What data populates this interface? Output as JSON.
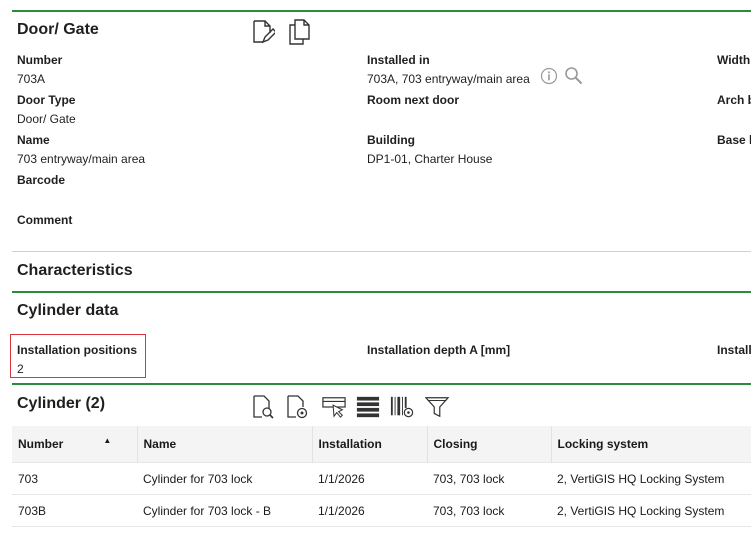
{
  "door": {
    "title": "Door/ Gate",
    "fields": {
      "number": {
        "label": "Number",
        "value": "703A"
      },
      "door_type": {
        "label": "Door Type",
        "value": "Door/ Gate"
      },
      "name": {
        "label": "Name",
        "value": "703 entryway/main area"
      },
      "barcode": {
        "label": "Barcode",
        "value": ""
      },
      "comment": {
        "label": "Comment",
        "value": ""
      },
      "installed_in": {
        "label": "Installed in",
        "value": "703A, 703 entryway/main area"
      },
      "room_next_door": {
        "label": "Room next door",
        "value": ""
      },
      "building": {
        "label": "Building",
        "value": "DP1-01, Charter House"
      },
      "width": {
        "label": "Width",
        "value": ""
      },
      "arch": {
        "label": "Arch b",
        "value": ""
      },
      "base": {
        "label": "Base h",
        "value": ""
      }
    }
  },
  "characteristics": {
    "title": "Characteristics"
  },
  "cylinder_data": {
    "title": "Cylinder data",
    "installation_positions": {
      "label": "Installation positions",
      "value": "2"
    },
    "installation_depth": {
      "label": "Installation depth A [mm]",
      "value": ""
    },
    "install_cut": {
      "label": "Install",
      "value": ""
    }
  },
  "cylinder_list": {
    "title": "Cylinder (2)",
    "columns": [
      "Number",
      "Name",
      "Installation",
      "Closing",
      "Locking system"
    ],
    "rows": [
      [
        "703",
        "Cylinder for 703 lock",
        "1/1/2026",
        "703, 703 lock",
        "2, VertiGIS HQ Locking System"
      ],
      [
        "703B",
        "Cylinder for 703 lock - B",
        "1/1/2026",
        "703, 703 lock",
        "2, VertiGIS HQ Locking System"
      ]
    ]
  },
  "icons": {
    "edit": "edit-document-icon",
    "copy": "copy-document-icon",
    "info": "info-icon",
    "search": "search-icon",
    "doc_search": "document-search-icon",
    "doc_settings": "document-settings-icon",
    "cursor_card": "card-cursor-icon",
    "list": "list-icon",
    "barcode": "barcode-settings-icon",
    "filter": "filter-icon"
  },
  "colors": {
    "accent": "#2e8b3e",
    "highlight": "#d9363e"
  }
}
